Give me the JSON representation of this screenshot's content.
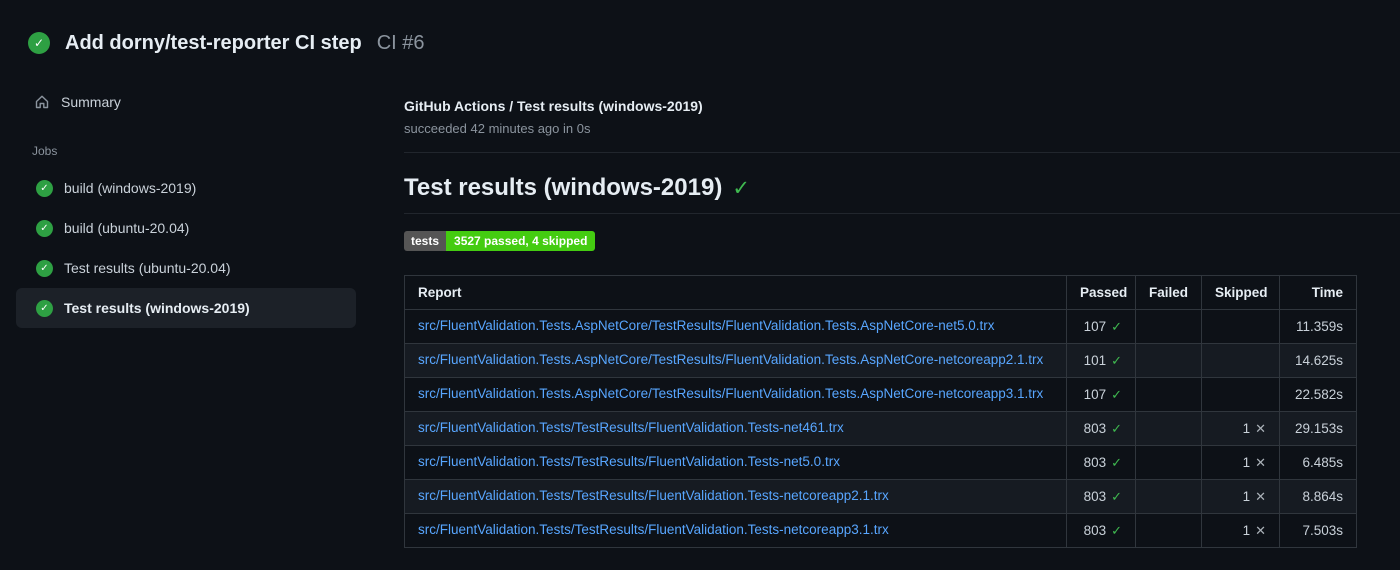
{
  "icons": {
    "check": "✓",
    "cross": "✕"
  },
  "colors": {
    "page_background": "#0d1117",
    "success_green": "#2ea043",
    "check_green": "#3fb950",
    "link_blue": "#58a6ff",
    "muted_text": "#8b949e",
    "badge_label_bg": "#555555",
    "badge_value_bg": "#44cc11",
    "table_border": "#30363d",
    "row_alt_bg": "#161b22"
  },
  "header": {
    "title": "Add dorny/test-reporter CI step",
    "run_number": "CI #6"
  },
  "sidebar": {
    "summary_label": "Summary",
    "jobs_label": "Jobs",
    "jobs": [
      {
        "label": "build (windows-2019)",
        "status": "success",
        "selected": false
      },
      {
        "label": "build (ubuntu-20.04)",
        "status": "success",
        "selected": false
      },
      {
        "label": "Test results (ubuntu-20.04)",
        "status": "success",
        "selected": false
      },
      {
        "label": "Test results (windows-2019)",
        "status": "success",
        "selected": true
      }
    ]
  },
  "main": {
    "check_title": "GitHub Actions / Test results (windows-2019)",
    "check_status_line": "succeeded 42 minutes ago in 0s",
    "section_heading": "Test results (windows-2019)",
    "badge": {
      "label": "tests",
      "value": "3527 passed, 4 skipped"
    },
    "table": {
      "columns": [
        "Report",
        "Passed",
        "Failed",
        "Skipped",
        "Time"
      ],
      "rows": [
        {
          "report": "src/FluentValidation.Tests.AspNetCore/TestResults/FluentValidation.Tests.AspNetCore-net5.0.trx",
          "passed": "107",
          "failed": "",
          "skipped": "",
          "time": "11.359s"
        },
        {
          "report": "src/FluentValidation.Tests.AspNetCore/TestResults/FluentValidation.Tests.AspNetCore-netcoreapp2.1.trx",
          "passed": "101",
          "failed": "",
          "skipped": "",
          "time": "14.625s"
        },
        {
          "report": "src/FluentValidation.Tests.AspNetCore/TestResults/FluentValidation.Tests.AspNetCore-netcoreapp3.1.trx",
          "passed": "107",
          "failed": "",
          "skipped": "",
          "time": "22.582s"
        },
        {
          "report": "src/FluentValidation.Tests/TestResults/FluentValidation.Tests-net461.trx",
          "passed": "803",
          "failed": "",
          "skipped": "1",
          "time": "29.153s"
        },
        {
          "report": "src/FluentValidation.Tests/TestResults/FluentValidation.Tests-net5.0.trx",
          "passed": "803",
          "failed": "",
          "skipped": "1",
          "time": "6.485s"
        },
        {
          "report": "src/FluentValidation.Tests/TestResults/FluentValidation.Tests-netcoreapp2.1.trx",
          "passed": "803",
          "failed": "",
          "skipped": "1",
          "time": "8.864s"
        },
        {
          "report": "src/FluentValidation.Tests/TestResults/FluentValidation.Tests-netcoreapp3.1.trx",
          "passed": "803",
          "failed": "",
          "skipped": "1",
          "time": "7.503s"
        }
      ]
    }
  }
}
